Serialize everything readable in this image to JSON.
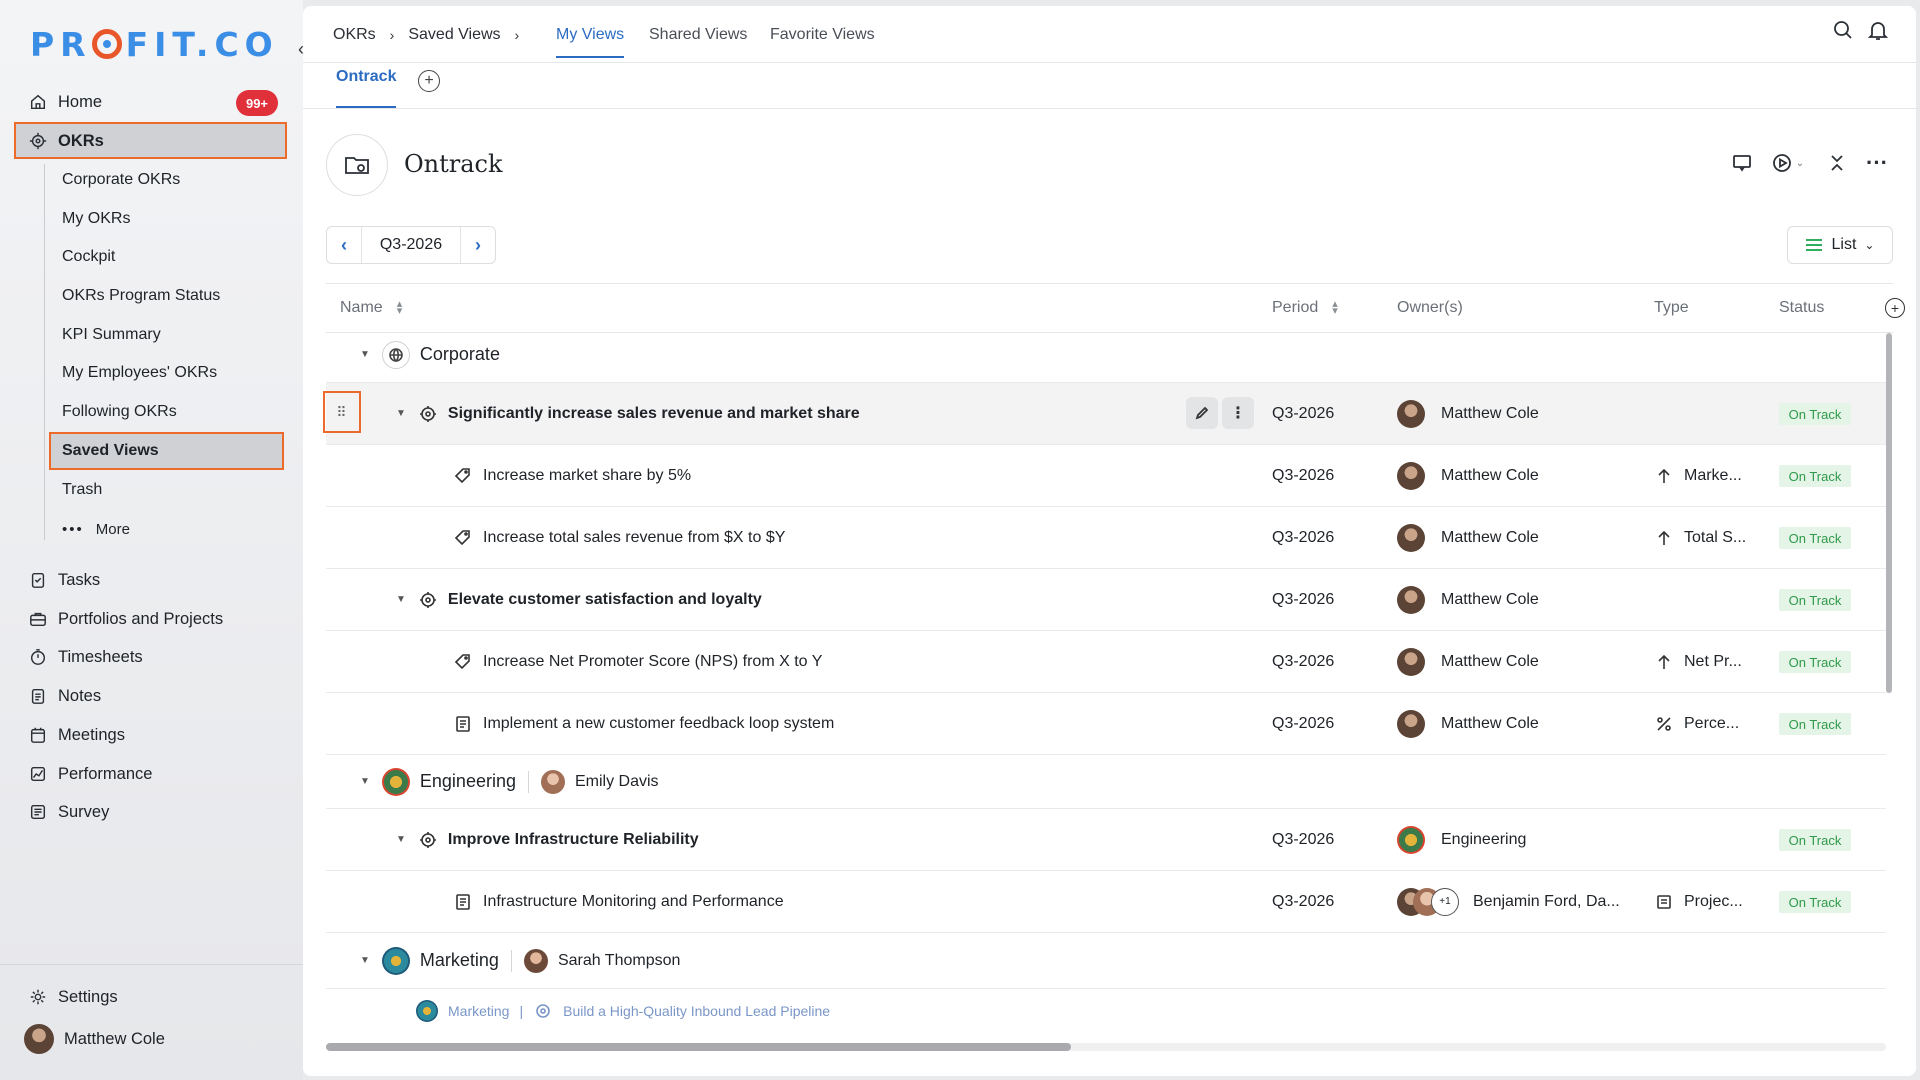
{
  "brand": {
    "logo_text_a": "PR",
    "logo_text_b": "FIT.CO"
  },
  "sidebar": {
    "collapse_icon": "chevron-left-icon",
    "home": {
      "label": "Home",
      "badge": "99+"
    },
    "okrs": {
      "label": "OKRs"
    },
    "okr_children": [
      "Corporate OKRs",
      "My OKRs",
      "Cockpit",
      "OKRs Program Status",
      "KPI Summary",
      "My Employees' OKRs",
      "Following OKRs",
      "Saved Views",
      "Trash"
    ],
    "more_label": "More",
    "items": [
      "Tasks",
      "Portfolios and Projects",
      "Timesheets",
      "Notes",
      "Meetings",
      "Performance",
      "Survey"
    ],
    "settings_label": "Settings",
    "user_name": "Matthew Cole"
  },
  "header": {
    "breadcrumb": [
      "OKRs",
      "Saved Views"
    ],
    "breadcrumb_sep": "›",
    "tabs": [
      "My Views",
      "Shared Views",
      "Favorite Views"
    ],
    "active_tab": "My Views"
  },
  "subtabs": {
    "active": "Ontrack"
  },
  "view": {
    "title": "Ontrack"
  },
  "period": {
    "value": "Q3-2026"
  },
  "view_mode": {
    "label": "List"
  },
  "table": {
    "columns": {
      "name": "Name",
      "period": "Period",
      "owners": "Owner(s)",
      "type": "Type",
      "status": "Status"
    },
    "groups": {
      "corporate": "Corporate",
      "engineering": {
        "name": "Engineering",
        "owner": "Emily Davis"
      },
      "marketing": {
        "name": "Marketing",
        "owner": "Sarah Thompson"
      }
    },
    "rows": [
      {
        "name": "Significantly increase sales revenue and market share",
        "period": "Q3-2026",
        "owner": "Matthew Cole",
        "type": "",
        "status": "On Track"
      },
      {
        "name": "Increase market share by 5%",
        "period": "Q3-2026",
        "owner": "Matthew Cole",
        "type": "Marke...",
        "status": "On Track"
      },
      {
        "name": "Increase total sales revenue from $X to $Y",
        "period": "Q3-2026",
        "owner": "Matthew Cole",
        "type": "Total S...",
        "status": "On Track"
      },
      {
        "name": "Elevate customer satisfaction and loyalty",
        "period": "Q3-2026",
        "owner": "Matthew Cole",
        "type": "",
        "status": "On Track"
      },
      {
        "name": "Increase Net Promoter Score (NPS) from X to Y",
        "period": "Q3-2026",
        "owner": "Matthew Cole",
        "type": "Net Pr...",
        "status": "On Track"
      },
      {
        "name": "Implement a new customer feedback loop system",
        "period": "Q3-2026",
        "owner": "Matthew Cole",
        "type": "Perce...",
        "status": "On Track"
      },
      {
        "name": "Improve Infrastructure Reliability",
        "period": "Q3-2026",
        "owner": "Engineering",
        "type": "",
        "status": "On Track"
      },
      {
        "name": "Infrastructure Monitoring and Performance",
        "period": "Q3-2026",
        "owner": "Benjamin Ford, Da...",
        "extra_owners": "+1",
        "type": "Projec...",
        "status": "On Track"
      }
    ],
    "partial_row": {
      "group": "Marketing",
      "sep": "|",
      "objective": "Build a High-Quality Inbound Lead Pipeline"
    }
  },
  "colors": {
    "accent": "#2b6cc2",
    "highlight": "#ec6a2a",
    "badge": "#e0303a",
    "status_bg": "#e4f4e6",
    "status_fg": "#2f9a4a"
  }
}
